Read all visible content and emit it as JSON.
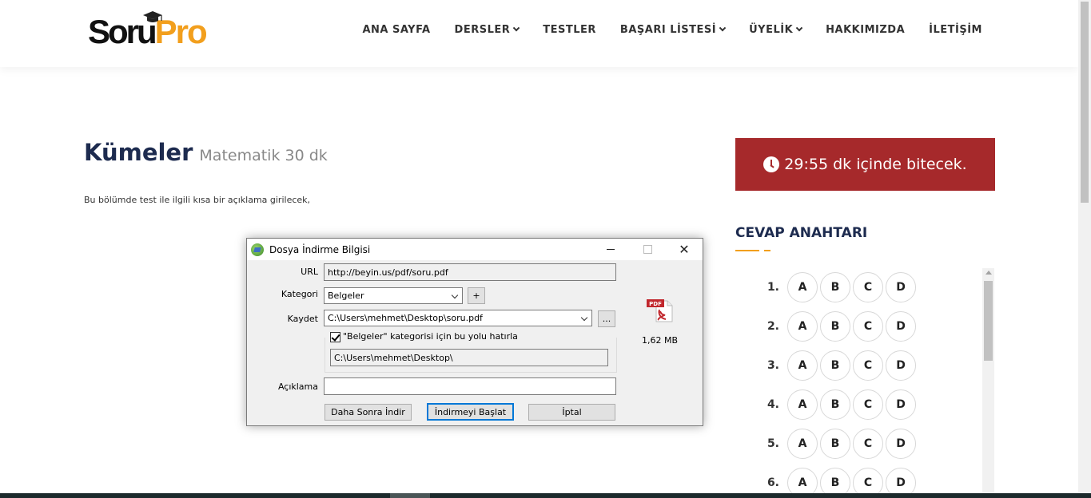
{
  "header": {
    "logo": {
      "part1": "Soru",
      "part2": "Pro"
    },
    "nav": [
      {
        "label": "ANA SAYFA",
        "dropdown": false
      },
      {
        "label": "DERSLER",
        "dropdown": true
      },
      {
        "label": "TESTLER",
        "dropdown": false
      },
      {
        "label": "BAŞARI LİSTESİ",
        "dropdown": true
      },
      {
        "label": "ÜYELİK",
        "dropdown": true
      },
      {
        "label": "HAKKIMIZDA",
        "dropdown": false
      },
      {
        "label": "İLETİŞİM",
        "dropdown": false
      }
    ]
  },
  "main": {
    "title": "Kümeler",
    "subtitle": "Matematik 30 dk",
    "description": "Bu bölümde test ile ilgili kısa bir açıklama girilecek,"
  },
  "timer": {
    "text": "29:55 dk içinde bitecek.",
    "color": "#a6292b"
  },
  "answer_key": {
    "title": "CEVAP ANAHTARI",
    "options": [
      "A",
      "B",
      "C",
      "D"
    ],
    "questions": [
      "1.",
      "2.",
      "3.",
      "4.",
      "5.",
      "6."
    ]
  },
  "dialog": {
    "title": "Dosya İndirme Bilgisi",
    "url_label": "URL",
    "url_value": "http://beyin.us/pdf/soru.pdf",
    "category_label": "Kategori",
    "category_value": "Belgeler",
    "add_button": "+",
    "save_label": "Kaydet",
    "save_value": "C:\\Users\\mehmet\\Desktop\\soru.pdf",
    "browse_button": "...",
    "remember_label": "\"Belgeler\" kategorisi için bu yolu hatırla",
    "remember_checked": true,
    "remembered_path": "C:\\Users\\mehmet\\Desktop\\",
    "description_label": "Açıklama",
    "description_value": "",
    "file_size": "1,62  MB",
    "pdf_badge": "PDF",
    "buttons": {
      "later": "Daha Sonra İndir",
      "start": "İndirmeyi Başlat",
      "cancel": "İptal"
    }
  },
  "colors": {
    "brand_orange": "#f29f1d",
    "navy": "#1d2b4f",
    "timer_red": "#a6292b"
  }
}
